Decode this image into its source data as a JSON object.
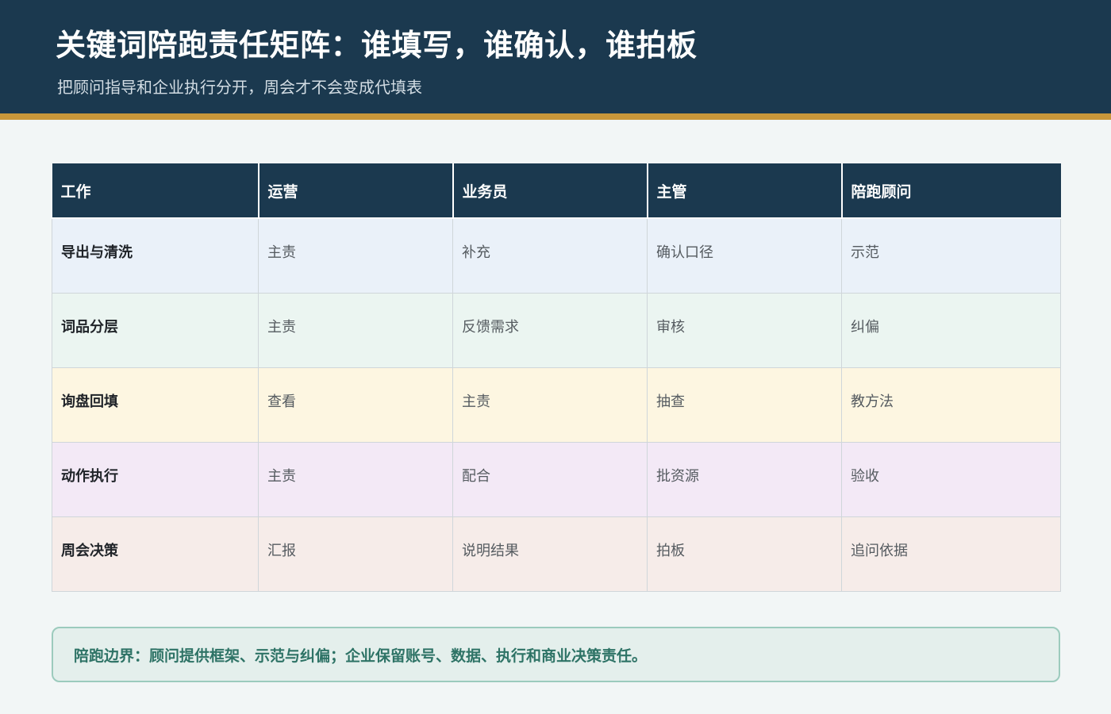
{
  "header": {
    "title": "关键词陪跑责任矩阵：谁填写，谁确认，谁拍板",
    "subtitle": "把顾问指导和企业执行分开，周会才不会变成代填表"
  },
  "matrix": {
    "columns": [
      "工作",
      "运营",
      "业务员",
      "主管",
      "陪跑顾问"
    ],
    "rows": [
      [
        "导出与清洗",
        "主责",
        "补充",
        "确认口径",
        "示范"
      ],
      [
        "词品分层",
        "主责",
        "反馈需求",
        "审核",
        "纠偏"
      ],
      [
        "询盘回填",
        "查看",
        "主责",
        "抽查",
        "教方法"
      ],
      [
        "动作执行",
        "主责",
        "配合",
        "批资源",
        "验收"
      ],
      [
        "周会决策",
        "汇报",
        "说明结果",
        "拍板",
        "追问依据"
      ]
    ]
  },
  "note": {
    "text": "陪跑边界：顾问提供框架、示范与纠偏；企业保留账号、数据、执行和商业决策责任。"
  },
  "colors": {
    "header_bg": "#1b394f",
    "accent_stripe": "#c9973a",
    "row_backgrounds": [
      "#eaf1f9",
      "#ebf5f1",
      "#fdf6e1",
      "#f3e9f6",
      "#f6ece9"
    ],
    "note_text": "#2e7366"
  }
}
